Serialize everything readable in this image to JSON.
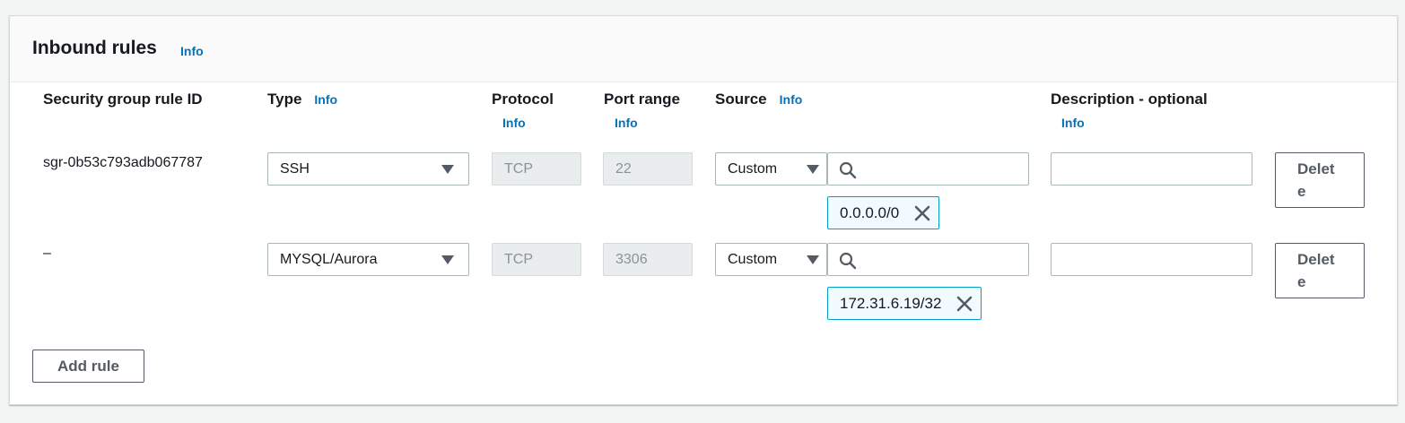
{
  "panel": {
    "title": "Inbound rules",
    "info": "Info"
  },
  "columns": {
    "rule_id": "Security group rule ID",
    "type": "Type",
    "type_info": "Info",
    "protocol": "Protocol",
    "protocol_info": "Info",
    "port_range": "Port range",
    "port_range_info": "Info",
    "source": "Source",
    "source_info": "Info",
    "description": "Description - optional",
    "description_info": "Info"
  },
  "rules": [
    {
      "rule_id": "sgr-0b53c793adb067787",
      "type": "SSH",
      "protocol": "TCP",
      "port_range": "22",
      "source_mode": "Custom",
      "search_value": "",
      "cidr": "0.0.0.0/0",
      "description": "",
      "delete_label": "Delete"
    },
    {
      "rule_id": "–",
      "type": "MYSQL/Aurora",
      "protocol": "TCP",
      "port_range": "3306",
      "source_mode": "Custom",
      "search_value": "",
      "cidr": "172.31.6.19/32",
      "description": "",
      "delete_label": "Delete"
    }
  ],
  "add_rule_label": "Add rule",
  "icons": {
    "search": "search-icon",
    "remove": "close-icon",
    "dropdown": "caret-down-icon"
  },
  "colors": {
    "link": "#0073bb",
    "token_border": "#00a1c9",
    "token_bg": "#f1faff"
  }
}
